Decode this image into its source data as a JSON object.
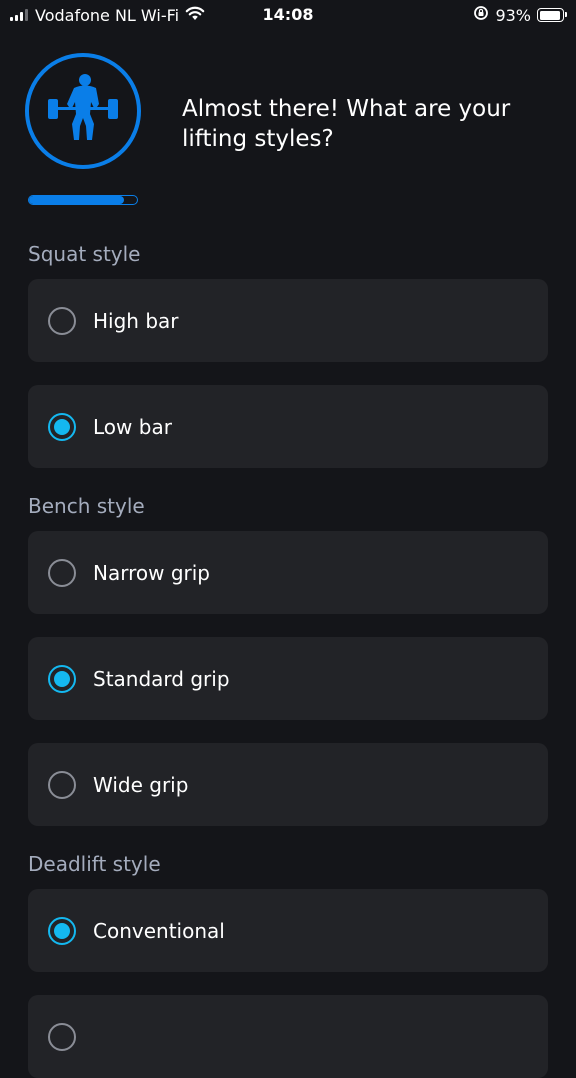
{
  "status_bar": {
    "carrier": "Vodafone NL Wi-Fi",
    "time": "14:08",
    "battery_percent": "93%",
    "battery_level": 0.93
  },
  "header": {
    "headline": "Almost there! What are your lifting styles?",
    "logo_icon": "weightlifter-icon",
    "progress_fraction": 0.88
  },
  "colors": {
    "accent_blue": "#0a7ee8",
    "radio_selected": "#14b8f0",
    "card_bg": "#222327",
    "page_bg": "#141519",
    "section_title": "#a4acbd"
  },
  "sections": [
    {
      "title": "Squat style",
      "options": [
        {
          "label": "High bar",
          "selected": false
        },
        {
          "label": "Low bar",
          "selected": true
        }
      ]
    },
    {
      "title": "Bench style",
      "options": [
        {
          "label": "Narrow grip",
          "selected": false
        },
        {
          "label": "Standard grip",
          "selected": true
        },
        {
          "label": "Wide grip",
          "selected": false
        }
      ]
    },
    {
      "title": "Deadlift style",
      "options": [
        {
          "label": "Conventional",
          "selected": true
        },
        {
          "label": "",
          "selected": false
        }
      ]
    }
  ]
}
